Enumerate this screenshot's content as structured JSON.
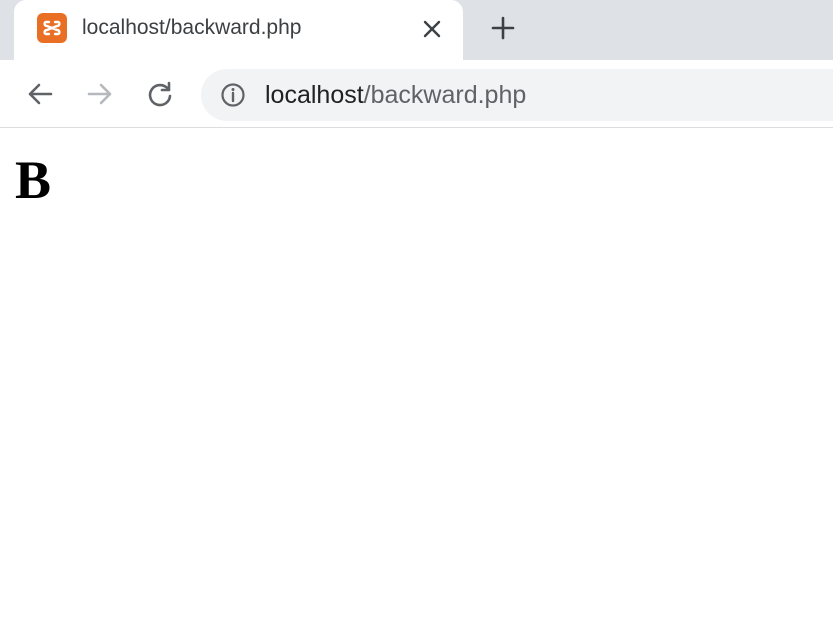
{
  "browser": {
    "tab": {
      "title": "localhost/backward.php",
      "favicon_icon": "xampp-logo-icon",
      "favicon_color": "#e86f24"
    },
    "toolbar": {
      "back_icon": "arrow-left-icon",
      "forward_icon": "arrow-right-icon",
      "reload_icon": "reload-icon",
      "address": {
        "host": "localhost",
        "path": "/backward.php",
        "info_icon": "info-icon"
      }
    },
    "colors": {
      "tabstrip_bg": "#dee1e6",
      "omnibox_bg": "#f1f3f4",
      "icon": "#5f6368",
      "icon_disabled": "#b5b8bc"
    }
  },
  "page": {
    "heading": "B"
  }
}
